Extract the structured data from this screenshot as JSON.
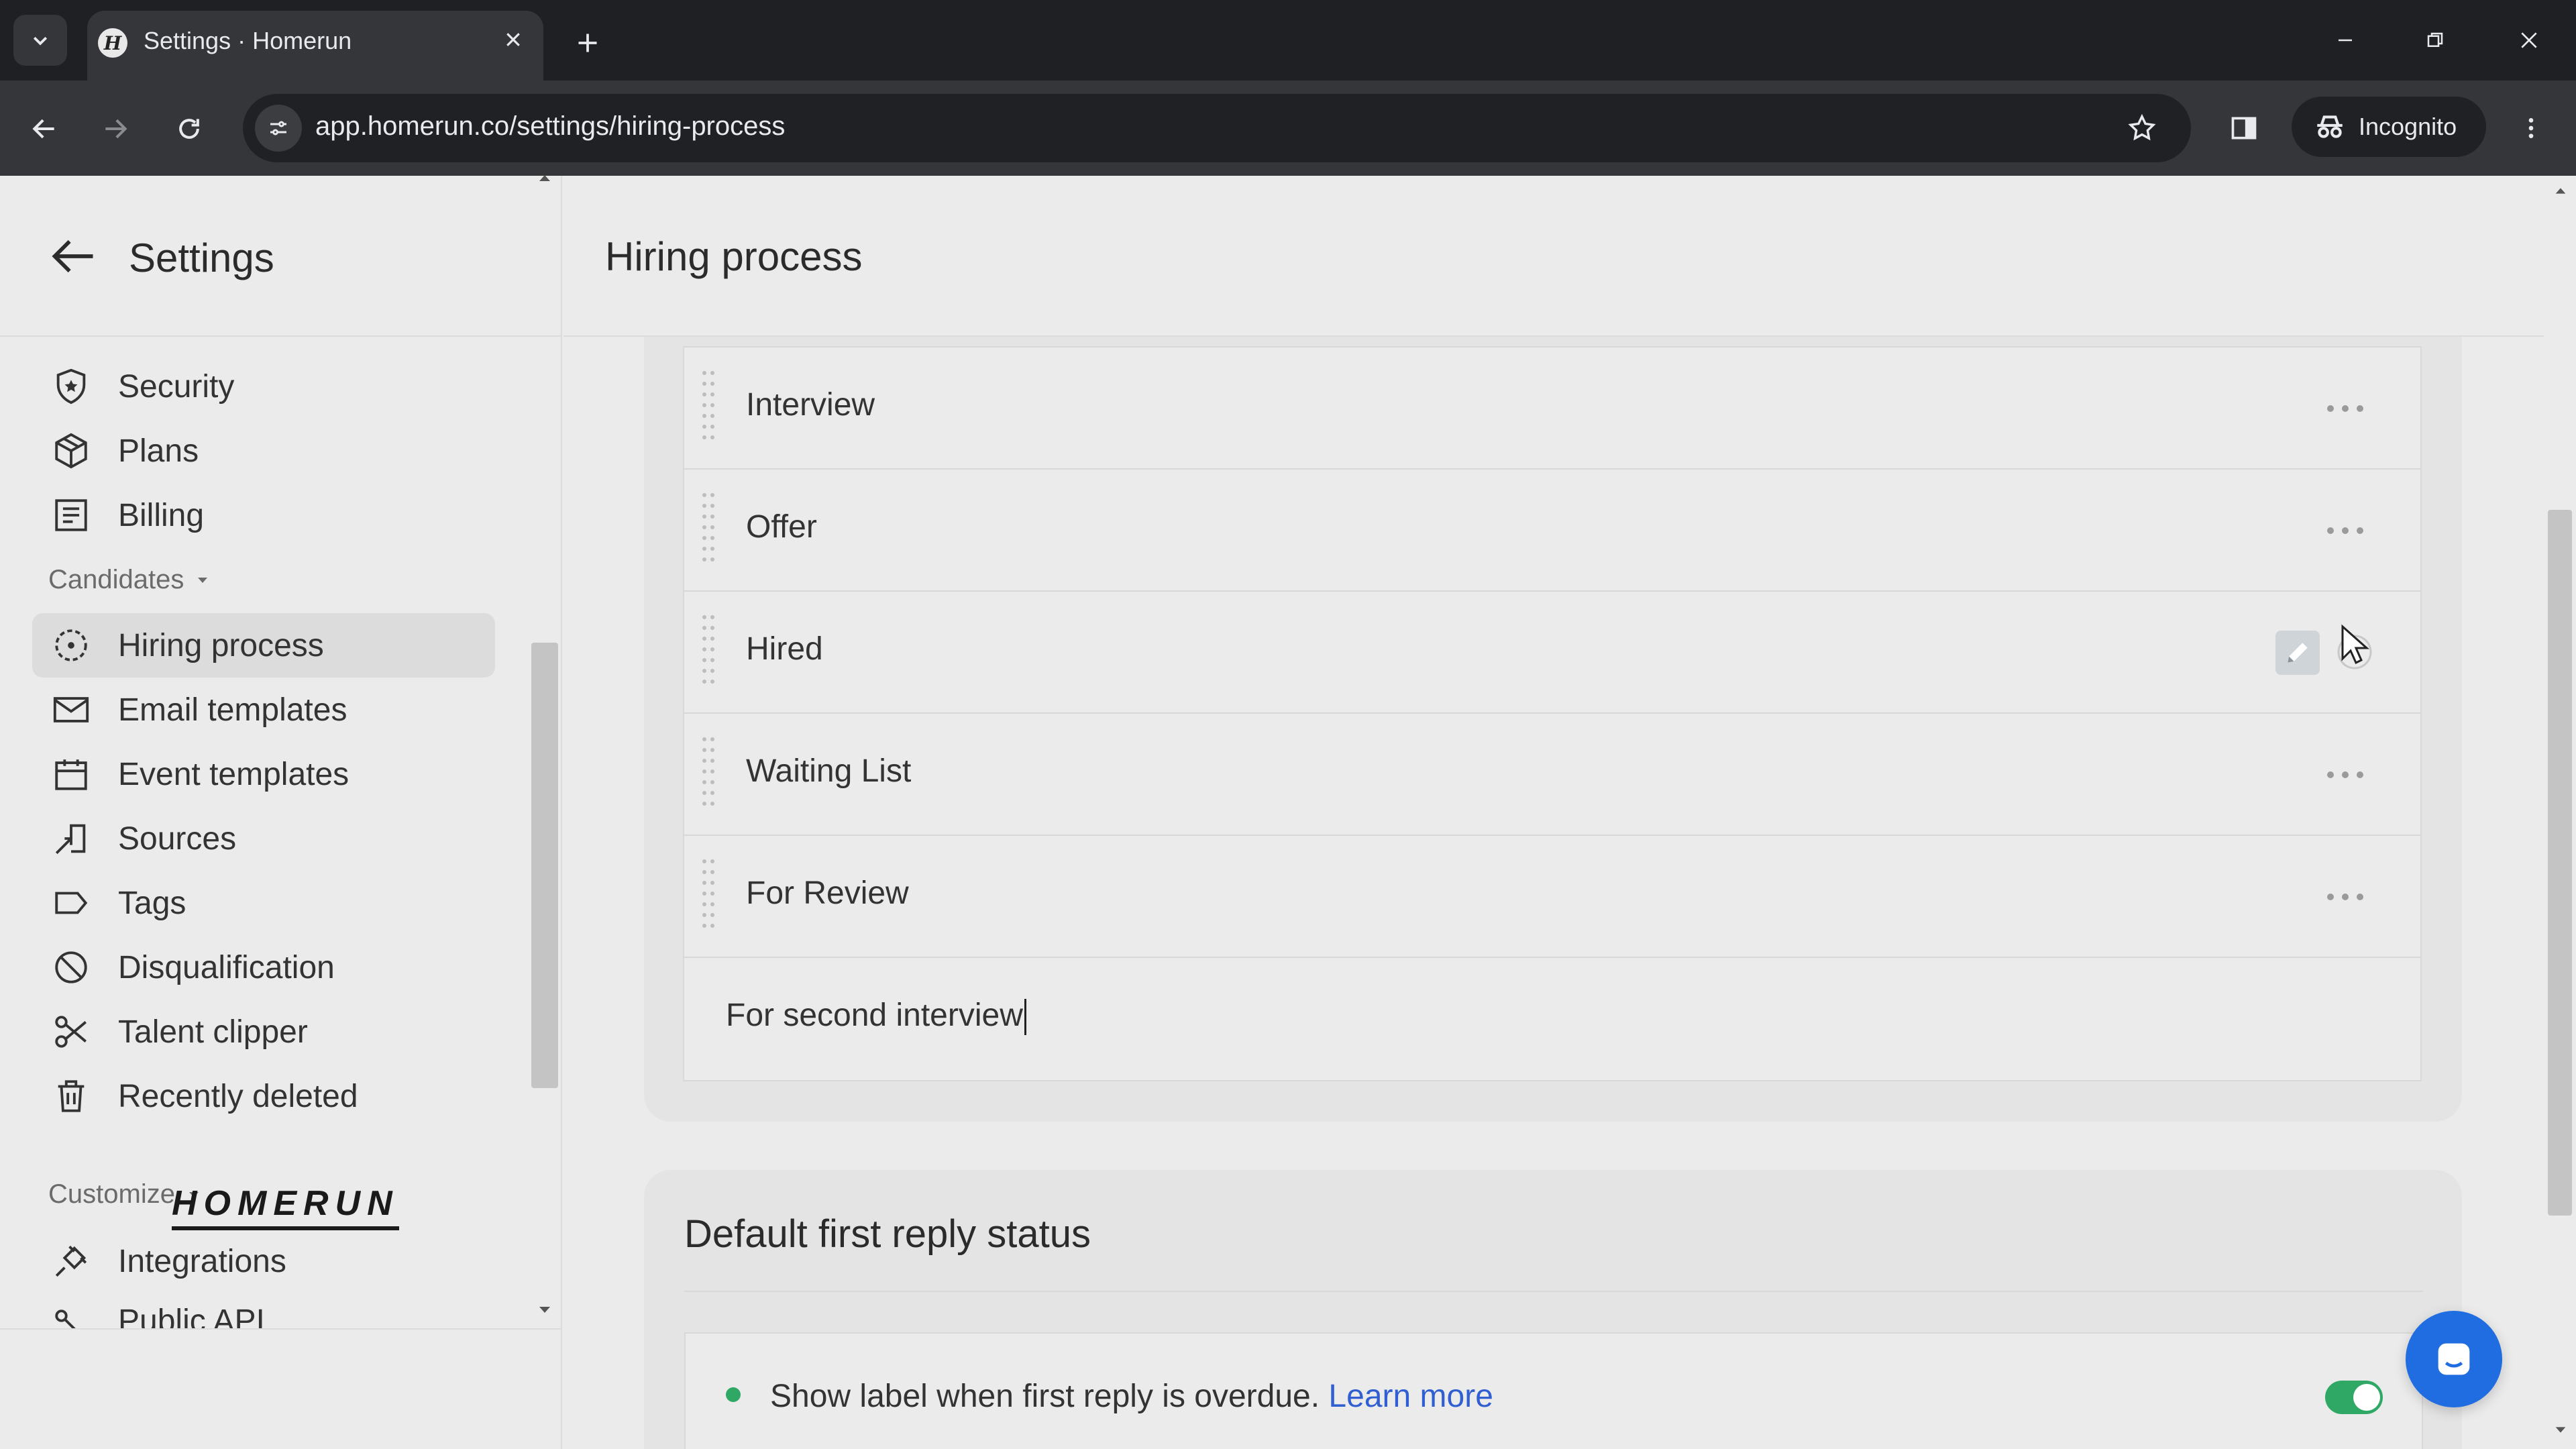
{
  "browser": {
    "tab_title": "Settings · Homerun",
    "favicon_letter": "H",
    "url": "app.homerun.co/settings/hiring-process",
    "profile_label": "Incognito"
  },
  "sidebar": {
    "title": "Settings",
    "top_items": [
      {
        "label": "Security",
        "icon": "shield-icon"
      },
      {
        "label": "Plans",
        "icon": "box-icon"
      },
      {
        "label": "Billing",
        "icon": "receipt-icon"
      }
    ],
    "candidates_section": {
      "label": "Candidates",
      "items": [
        {
          "label": "Hiring process",
          "icon": "process-icon",
          "active": true
        },
        {
          "label": "Email templates",
          "icon": "mail-icon"
        },
        {
          "label": "Event templates",
          "icon": "calendar-icon"
        },
        {
          "label": "Sources",
          "icon": "source-icon"
        },
        {
          "label": "Tags",
          "icon": "tag-icon"
        },
        {
          "label": "Disqualification",
          "icon": "ban-icon"
        },
        {
          "label": "Talent clipper",
          "icon": "scissors-icon"
        },
        {
          "label": "Recently deleted",
          "icon": "trash-icon"
        }
      ]
    },
    "customize_section": {
      "label": "Customize",
      "items": [
        {
          "label": "Integrations",
          "icon": "plug-icon"
        },
        {
          "label": "Public API",
          "icon": "api-icon"
        }
      ]
    },
    "logo_text": "HOMERUN"
  },
  "main": {
    "title": "Hiring process",
    "stages": [
      {
        "name": "Interview"
      },
      {
        "name": "Offer"
      },
      {
        "name": "Hired"
      },
      {
        "name": "Waiting List"
      },
      {
        "name": "For Review"
      }
    ],
    "new_stage_value": "For second interview",
    "reply_card": {
      "title": "Default first reply status",
      "text": "Show label when first reply is overdue.",
      "link": "Learn more",
      "toggle_on": true
    }
  },
  "colors": {
    "accent_green": "#2fa866",
    "link_blue": "#2f5fd0",
    "chat_blue": "#1f6de0"
  }
}
